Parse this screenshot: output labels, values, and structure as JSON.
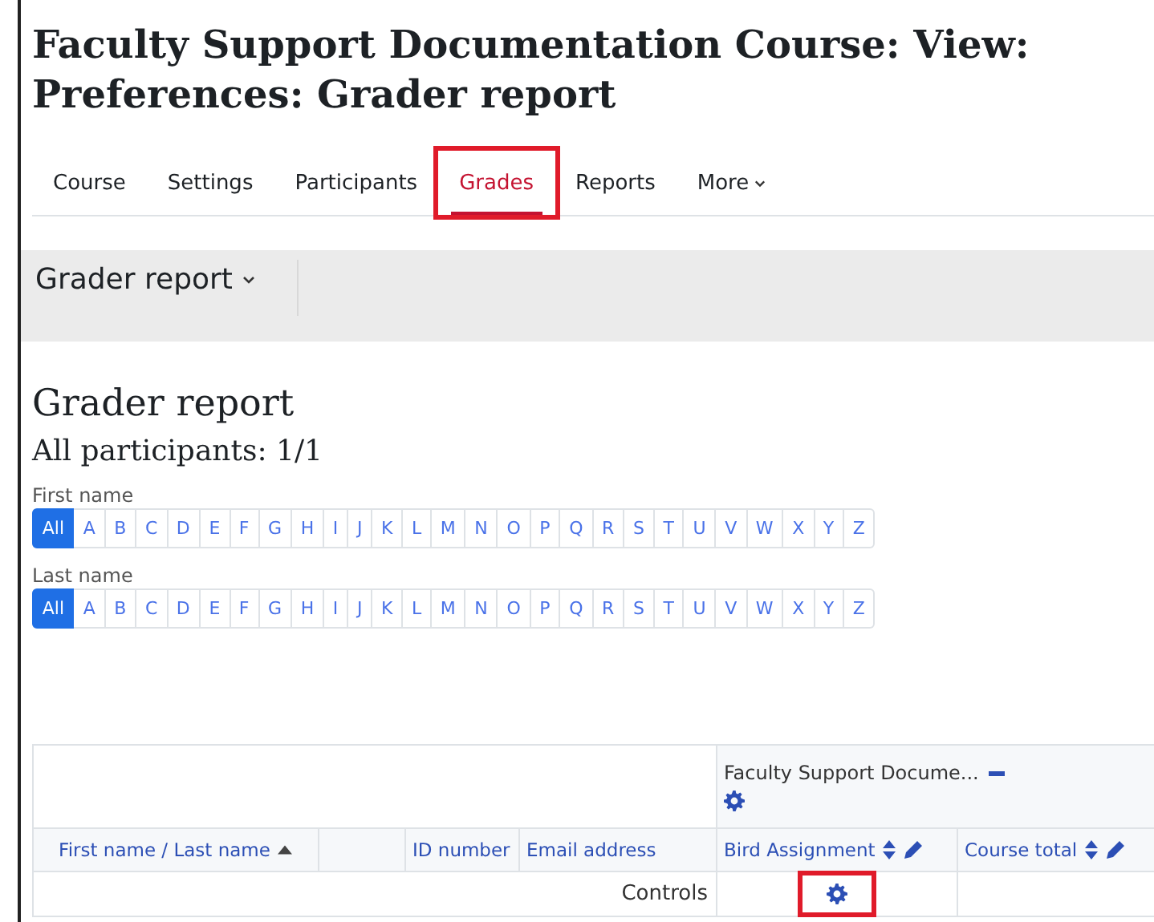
{
  "page_title": "Faculty Support Documentation Course: View: Preferences: Grader report",
  "tabs": [
    {
      "label": "Course",
      "selected": false,
      "highlighted": false
    },
    {
      "label": "Settings",
      "selected": false,
      "highlighted": false
    },
    {
      "label": "Participants",
      "selected": false,
      "highlighted": false
    },
    {
      "label": "Grades",
      "selected": true,
      "highlighted": true
    },
    {
      "label": "Reports",
      "selected": false,
      "highlighted": false
    },
    {
      "label": "More",
      "selected": false,
      "highlighted": false,
      "kind": "dropdown"
    }
  ],
  "report_menu": {
    "label": "Grader report"
  },
  "heading": "Grader report",
  "subheading": "All participants: 1/1",
  "filters": [
    {
      "label": "First name",
      "initials": [
        {
          "label": "All",
          "selected": true
        },
        {
          "label": "A",
          "selected": false
        },
        {
          "label": "B",
          "selected": false
        },
        {
          "label": "C",
          "selected": false
        },
        {
          "label": "D",
          "selected": false
        },
        {
          "label": "E",
          "selected": false
        },
        {
          "label": "F",
          "selected": false
        },
        {
          "label": "G",
          "selected": false
        },
        {
          "label": "H",
          "selected": false
        },
        {
          "label": "I",
          "selected": false
        },
        {
          "label": "J",
          "selected": false
        },
        {
          "label": "K",
          "selected": false
        },
        {
          "label": "L",
          "selected": false
        },
        {
          "label": "M",
          "selected": false
        },
        {
          "label": "N",
          "selected": false
        },
        {
          "label": "O",
          "selected": false
        },
        {
          "label": "P",
          "selected": false
        },
        {
          "label": "Q",
          "selected": false
        },
        {
          "label": "R",
          "selected": false
        },
        {
          "label": "S",
          "selected": false
        },
        {
          "label": "T",
          "selected": false
        },
        {
          "label": "U",
          "selected": false
        },
        {
          "label": "V",
          "selected": false
        },
        {
          "label": "W",
          "selected": false
        },
        {
          "label": "X",
          "selected": false
        },
        {
          "label": "Y",
          "selected": false
        },
        {
          "label": "Z",
          "selected": false
        }
      ]
    },
    {
      "label": "Last name",
      "initials": [
        {
          "label": "All",
          "selected": true
        },
        {
          "label": "A",
          "selected": false
        },
        {
          "label": "B",
          "selected": false
        },
        {
          "label": "C",
          "selected": false
        },
        {
          "label": "D",
          "selected": false
        },
        {
          "label": "E",
          "selected": false
        },
        {
          "label": "F",
          "selected": false
        },
        {
          "label": "G",
          "selected": false
        },
        {
          "label": "H",
          "selected": false
        },
        {
          "label": "I",
          "selected": false
        },
        {
          "label": "J",
          "selected": false
        },
        {
          "label": "K",
          "selected": false
        },
        {
          "label": "L",
          "selected": false
        },
        {
          "label": "M",
          "selected": false
        },
        {
          "label": "N",
          "selected": false
        },
        {
          "label": "O",
          "selected": false
        },
        {
          "label": "P",
          "selected": false
        },
        {
          "label": "Q",
          "selected": false
        },
        {
          "label": "R",
          "selected": false
        },
        {
          "label": "S",
          "selected": false
        },
        {
          "label": "T",
          "selected": false
        },
        {
          "label": "U",
          "selected": false
        },
        {
          "label": "V",
          "selected": false
        },
        {
          "label": "W",
          "selected": false
        },
        {
          "label": "X",
          "selected": false
        },
        {
          "label": "Y",
          "selected": false
        },
        {
          "label": "Z",
          "selected": false
        }
      ]
    }
  ],
  "table": {
    "category": {
      "label": "Faculty Support Docume..."
    },
    "columns": [
      {
        "label": "First name / Last name",
        "kind": "sort-asc"
      },
      {
        "kind": "blank"
      },
      {
        "label": "ID number",
        "kind": "plain"
      },
      {
        "label": "Email address",
        "kind": "plain"
      },
      {
        "label": "Bird Assignment",
        "kind": "grade"
      },
      {
        "label": "Course total",
        "kind": "grade"
      }
    ],
    "controls_row": {
      "label": "Controls",
      "highlighted": true
    }
  }
}
